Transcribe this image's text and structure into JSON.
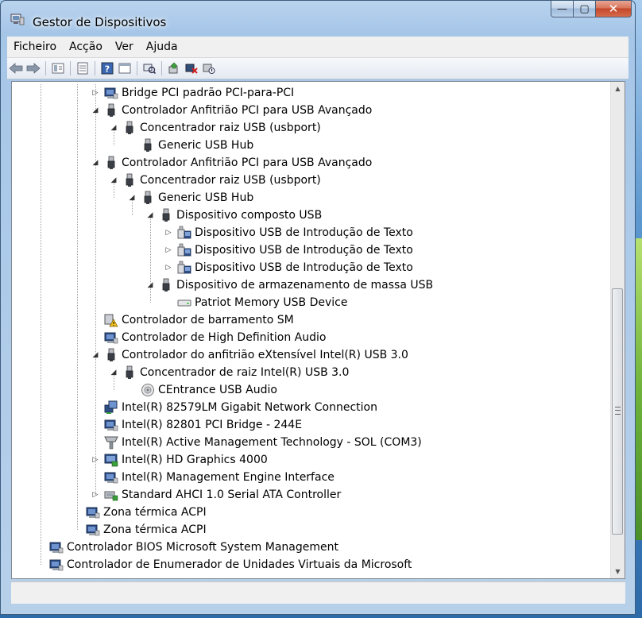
{
  "window": {
    "title": "Gestor de Dispositivos",
    "caption": {
      "minimize": "—",
      "maximize": "▢",
      "close": "✕"
    }
  },
  "menu": [
    "Ficheiro",
    "Acção",
    "Ver",
    "Ajuda"
  ],
  "toolbar_icons": [
    "back-icon",
    "forward-icon",
    "properties-view-icon",
    "list-view-icon",
    "help-icon",
    "details-view-icon",
    "scan-hardware-icon",
    "update-driver-icon",
    "uninstall-icon",
    "disable-icon"
  ],
  "tree": [
    {
      "label": "Bridge PCI padrão PCI-para-PCI",
      "expander": "closed",
      "icon": "pci-device-icon"
    },
    {
      "label": "Controlador Anfitrião PCI para USB Avançado",
      "expander": "open",
      "icon": "usb-plug-icon"
    },
    {
      "label": "Concentrador raiz USB (usbport)",
      "expander": "open",
      "icon": "usb-plug-icon"
    },
    {
      "label": "Generic USB Hub",
      "expander": "none",
      "icon": "usb-plug-icon"
    },
    {
      "label": "Controlador Anfitrião PCI para USB Avançado",
      "expander": "open",
      "icon": "usb-plug-icon"
    },
    {
      "label": "Concentrador raiz USB (usbport)",
      "expander": "open",
      "icon": "usb-plug-icon"
    },
    {
      "label": "Generic USB Hub",
      "expander": "open",
      "icon": "usb-plug-icon"
    },
    {
      "label": "Dispositivo composto USB",
      "expander": "open",
      "icon": "usb-plug-icon"
    },
    {
      "label": "Dispositivo USB de Introdução de Texto",
      "expander": "closed",
      "icon": "hid-device-icon"
    },
    {
      "label": "Dispositivo USB de Introdução de Texto",
      "expander": "closed",
      "icon": "hid-device-icon"
    },
    {
      "label": "Dispositivo USB de Introdução de Texto",
      "expander": "closed",
      "icon": "hid-device-icon"
    },
    {
      "label": "Dispositivo de armazenamento de massa USB",
      "expander": "open",
      "icon": "usb-plug-icon"
    },
    {
      "label": "Patriot Memory USB Device",
      "expander": "none",
      "icon": "drive-icon"
    },
    {
      "label": "Controlador de barramento SM",
      "expander": "none",
      "icon": "warning-device-icon"
    },
    {
      "label": "Controlador de High Definition Audio",
      "expander": "none",
      "icon": "pci-device-icon"
    },
    {
      "label": "Controlador do anfitrião eXtensível Intel(R) USB 3.0",
      "expander": "open",
      "icon": "usb-plug-icon"
    },
    {
      "label": "Concentrador de raiz Intel(R) USB 3.0",
      "expander": "open",
      "icon": "usb-plug-icon"
    },
    {
      "label": "CEntrance USB Audio",
      "expander": "none",
      "icon": "speaker-icon"
    },
    {
      "label": "Intel(R) 82579LM Gigabit Network Connection",
      "expander": "none",
      "icon": "network-adapter-icon"
    },
    {
      "label": "Intel(R) 82801 PCI Bridge - 244E",
      "expander": "none",
      "icon": "pci-device-icon"
    },
    {
      "label": "Intel(R) Active Management Technology - SOL (COM3)",
      "expander": "none",
      "icon": "port-icon"
    },
    {
      "label": "Intel(R) HD Graphics 4000",
      "expander": "closed",
      "icon": "display-adapter-icon"
    },
    {
      "label": "Intel(R) Management Engine Interface",
      "expander": "none",
      "icon": "pci-device-icon"
    },
    {
      "label": "Standard AHCI 1.0 Serial ATA Controller",
      "expander": "closed",
      "icon": "storage-controller-icon"
    },
    {
      "label": "Zona térmica ACPI",
      "expander": "none",
      "icon": "pci-device-icon"
    },
    {
      "label": "Zona térmica ACPI",
      "expander": "none",
      "icon": "pci-device-icon"
    },
    {
      "label": "Controlador BIOS Microsoft System Management",
      "expander": "none",
      "icon": "pci-device-icon"
    },
    {
      "label": "Controlador de Enumerador de Unidades Virtuais da Microsoft",
      "expander": "none",
      "icon": "pci-device-icon"
    }
  ],
  "colors": {
    "frame": "#b9d3ee",
    "content_bg": "#ffffff",
    "close_button": "#c4472a"
  }
}
